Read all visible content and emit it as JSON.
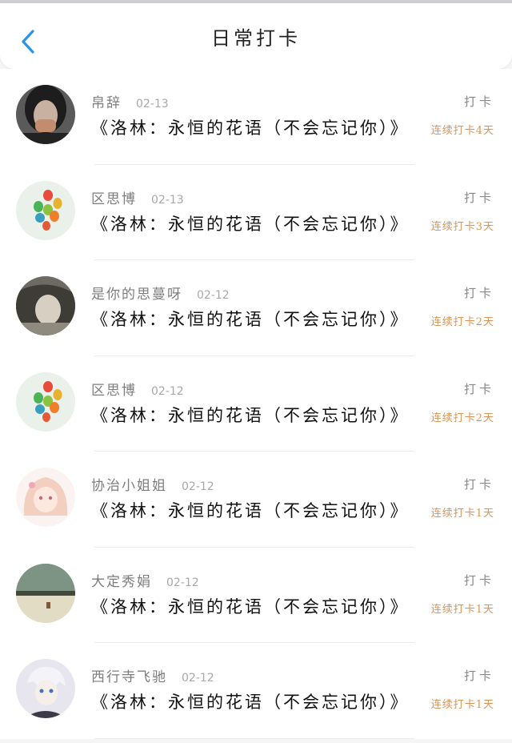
{
  "header": {
    "title": "日常打卡"
  },
  "items": [
    {
      "name": "帛辞",
      "date": "02-13",
      "book": "《洛林：永恒的花语（不会忘记你）》",
      "checkin": "打卡",
      "streak": "连续打卡4天",
      "avatar": "woman-mask-photo"
    },
    {
      "name": "区思博",
      "date": "02-13",
      "book": "《洛林：永恒的花语（不会忘记你）》",
      "checkin": "打卡",
      "streak": "连续打卡3天",
      "avatar": "balloons"
    },
    {
      "name": "是你的思蔓呀",
      "date": "02-12",
      "book": "《洛林：永恒的花语（不会忘记你）》",
      "checkin": "打卡",
      "streak": "连续打卡2天",
      "avatar": "woman-portrait-photo"
    },
    {
      "name": "区思博",
      "date": "02-12",
      "book": "《洛林：永恒的花语（不会忘记你）》",
      "checkin": "打卡",
      "streak": "连续打卡2天",
      "avatar": "balloons"
    },
    {
      "name": "协治小姐姐",
      "date": "02-12",
      "book": "《洛林：永恒的花语（不会忘记你）》",
      "checkin": "打卡",
      "streak": "连续打卡1天",
      "avatar": "anime-girl"
    },
    {
      "name": "大定秀娟",
      "date": "02-12",
      "book": "《洛林：永恒的花语（不会忘记你）》",
      "checkin": "打卡",
      "streak": "连续打卡1天",
      "avatar": "landscape-photo"
    },
    {
      "name": "西行寺飞驰",
      "date": "02-12",
      "book": "《洛林：永恒的花语（不会忘记你）》",
      "checkin": "打卡",
      "streak": "连续打卡1天",
      "avatar": "anime-boy"
    }
  ],
  "colors": {
    "accent": "#2b93e8",
    "streak": "#d99455"
  }
}
